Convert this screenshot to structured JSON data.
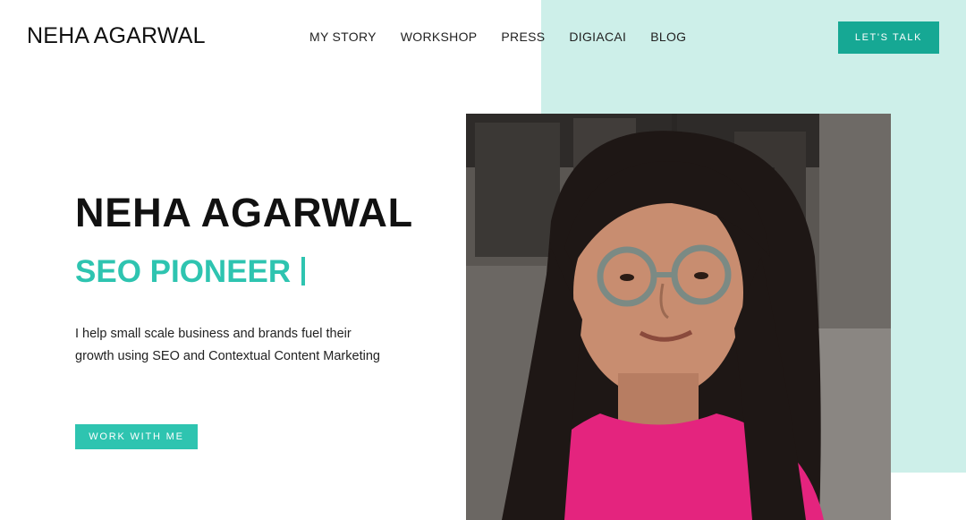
{
  "header": {
    "logo": "NEHA AGARWAL",
    "nav": [
      "MY STORY",
      "WORKSHOP",
      "PRESS",
      "DIGIACAI",
      "BLOG"
    ],
    "cta_label": "LET'S TALK"
  },
  "hero": {
    "name": "NEHA AGARWAL",
    "role": "SEO PIONEER",
    "description": "I help small scale business and brands fuel their growth using SEO and Contextual Content Marketing",
    "cta_label": "WORK WITH ME"
  },
  "colors": {
    "accent": "#2ec4b0",
    "accent_dark": "#16a894",
    "mint": "#cdefe9",
    "shirt": "#e4247e"
  }
}
